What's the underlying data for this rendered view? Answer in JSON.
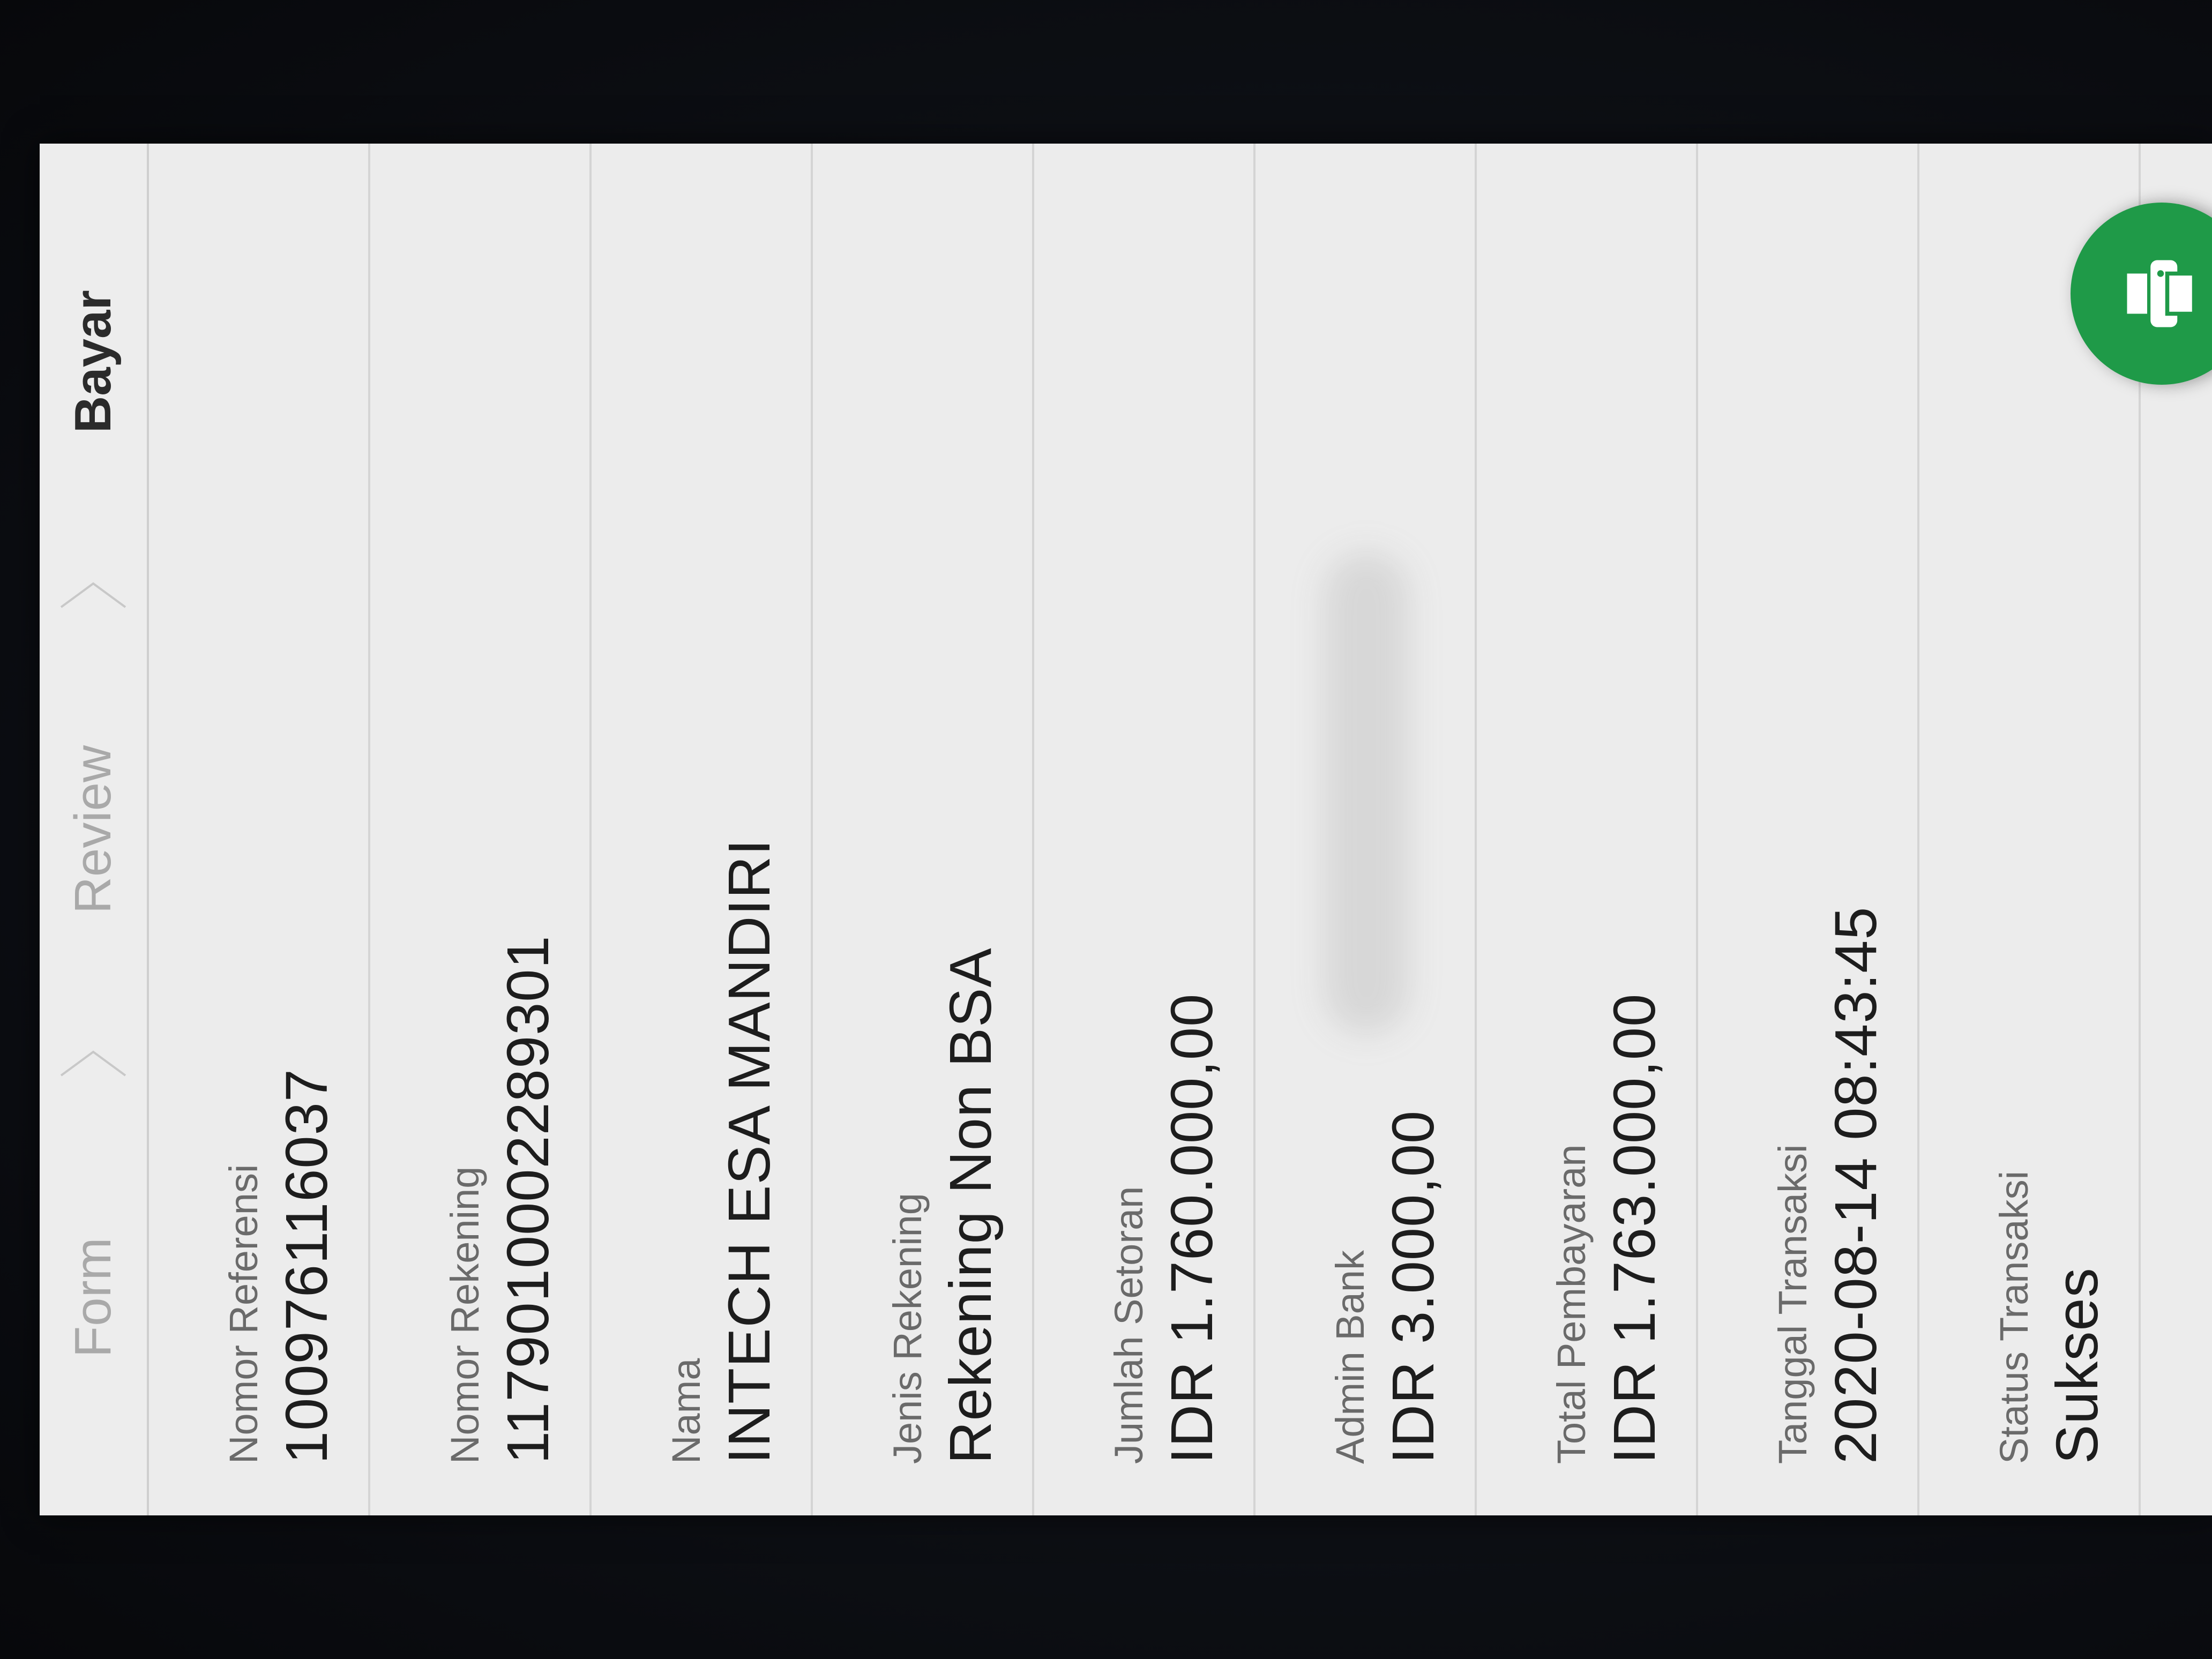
{
  "stepper": {
    "steps": [
      {
        "label": "Form",
        "active": false
      },
      {
        "label": "Review",
        "active": false
      },
      {
        "label": "Bayar",
        "active": true
      }
    ]
  },
  "fields": [
    {
      "label": "Nomor Referensi",
      "value": "100976116037"
    },
    {
      "label": "Nomor Rekening",
      "value": "1179010002289301"
    },
    {
      "label": "Nama",
      "value": "INTECH ESA MANDIRI"
    },
    {
      "label": "Jenis Rekening",
      "value": "Rekening Non BSA"
    },
    {
      "label": "Jumlah Setoran",
      "value": "IDR 1.760.000,00"
    },
    {
      "label": "Admin Bank",
      "value": "IDR 3.000,00"
    },
    {
      "label": "Total Pembayaran",
      "value": "IDR 1.763.000,00"
    },
    {
      "label": "Tanggal Transaksi",
      "value": "2020-08-14 08:43:45"
    },
    {
      "label": "Status Transaksi",
      "value": "Sukses"
    }
  ],
  "fab": {
    "icon": "printer-icon",
    "color": "#1f9a48"
  }
}
